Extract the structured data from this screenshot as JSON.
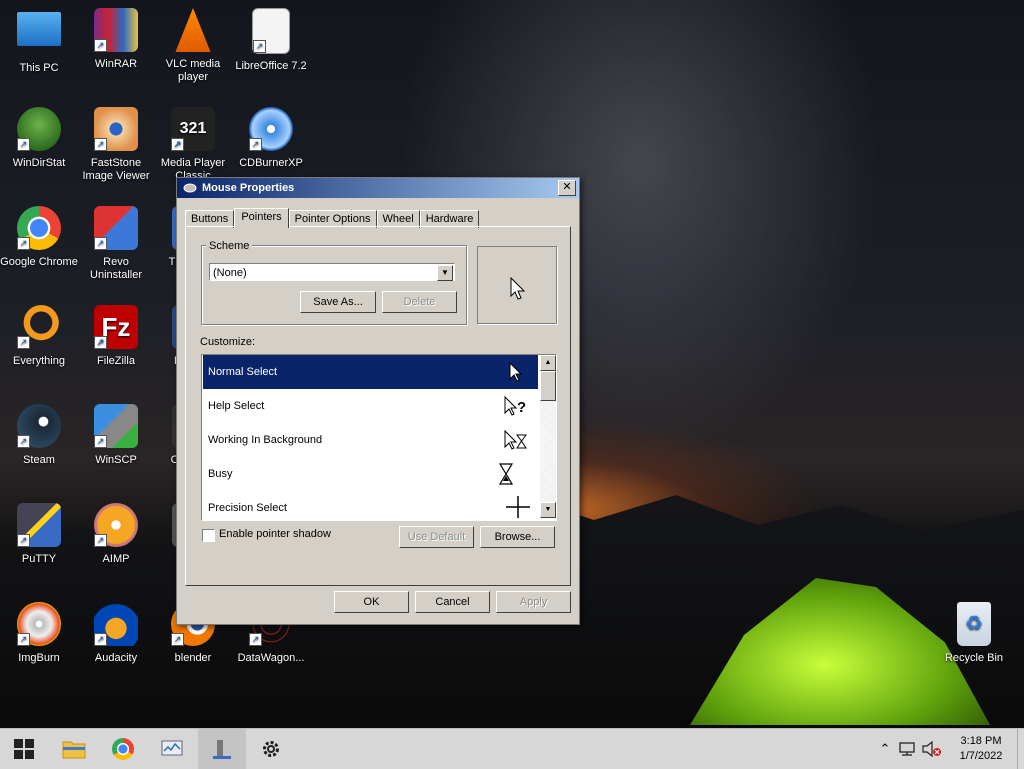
{
  "desktop": {
    "icons": [
      {
        "label": "This PC"
      },
      {
        "label": "WinRAR"
      },
      {
        "label": "VLC media player"
      },
      {
        "label": "LibreOffice 7.2"
      },
      {
        "label": "WinDirStat"
      },
      {
        "label": "FastStone Image Viewer"
      },
      {
        "label": "Media Player Classic"
      },
      {
        "label": "CDBurnerXP"
      },
      {
        "label": "Google Chrome"
      },
      {
        "label": "Revo Uninstaller"
      },
      {
        "label": "Th"
      },
      {
        "label": "Everything"
      },
      {
        "label": "FileZilla"
      },
      {
        "label": "D"
      },
      {
        "label": "Steam"
      },
      {
        "label": "WinSCP"
      },
      {
        "label": "Op"
      },
      {
        "label": "PuTTY"
      },
      {
        "label": "AIMP"
      },
      {
        "label": "F"
      },
      {
        "label": "ImgBurn"
      },
      {
        "label": "Audacity"
      },
      {
        "label": "blender"
      },
      {
        "label": "DataWagon..."
      },
      {
        "label": "Recycle Bin"
      }
    ]
  },
  "dialog": {
    "title": "Mouse Properties",
    "close_label": "✕",
    "tabs": [
      {
        "label": "Buttons"
      },
      {
        "label": "Pointers"
      },
      {
        "label": "Pointer Options"
      },
      {
        "label": "Wheel"
      },
      {
        "label": "Hardware"
      }
    ],
    "scheme": {
      "label": "Scheme",
      "selected": "(None)",
      "save_as_label": "Save As...",
      "delete_label": "Delete"
    },
    "customize": {
      "label": "Customize:",
      "items": [
        {
          "label": "Normal Select",
          "icon": "arrow-cursor-icon"
        },
        {
          "label": "Help Select",
          "icon": "help-cursor-icon"
        },
        {
          "label": "Working In Background",
          "icon": "working-cursor-icon"
        },
        {
          "label": "Busy",
          "icon": "hourglass-cursor-icon"
        },
        {
          "label": "Precision Select",
          "icon": "crosshair-cursor-icon"
        }
      ]
    },
    "shadow_label": "Enable pointer shadow",
    "use_default_label": "Use Default",
    "browse_label": "Browse...",
    "ok_label": "OK",
    "cancel_label": "Cancel",
    "apply_label": "Apply"
  },
  "taskbar": {
    "time": "3:18 PM",
    "date": "1/7/2022"
  }
}
